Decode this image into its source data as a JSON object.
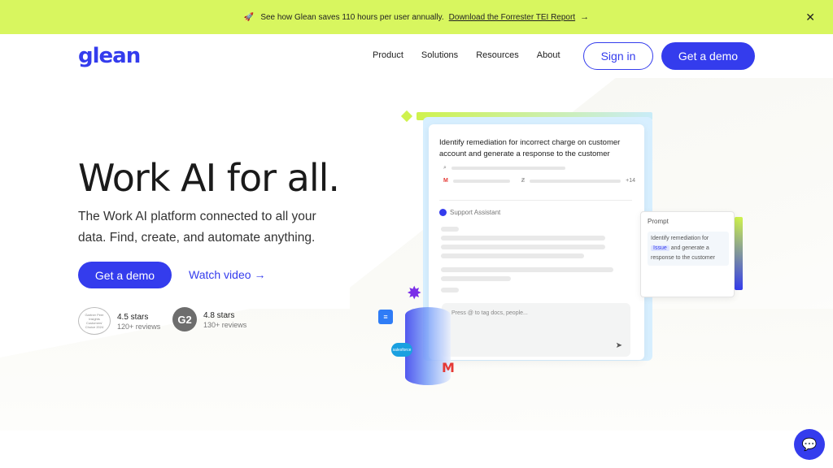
{
  "announcement": {
    "icon": "rocket-icon",
    "message": "See how Glean saves 110 hours per user annually.",
    "link_text": "Download the Forrester TEI Report",
    "arrow": "→",
    "close": "✕"
  },
  "nav": {
    "logo": "glean",
    "links": [
      "Product",
      "Solutions",
      "Resources",
      "About"
    ],
    "signin_label": "Sign in",
    "demo_label": "Get a demo"
  },
  "hero": {
    "title": "Work AI for all.",
    "subtitle": "The Work AI platform connected to all your data. Find, create, and automate anything.",
    "demo_label": "Get a demo",
    "watch_label": "Watch video",
    "watch_arrow": "→"
  },
  "badges": [
    {
      "logo_text": "Gartner Peer Insights Customers' Choice 2024",
      "stars": "4.5 stars",
      "reviews": "120+ reviews"
    },
    {
      "logo_text": "G2",
      "stars": "4.8 stars",
      "reviews": "130+ reviews"
    }
  ],
  "mockup": {
    "query": "Identify remediation for incorrect charge on customer account and generate a response to the customer",
    "source_count": "+14",
    "assistant_label": "Support Assistant",
    "input_placeholder": "Press @ to tag docs, people...",
    "send_icon": "➤",
    "prompt": {
      "title": "Prompt",
      "text_before": "Identify remediation for",
      "chip": "Issue",
      "text_after": "and generate a response to the customer"
    }
  },
  "floating": {
    "sf_label": "salesforce",
    "gmail_label": "M"
  },
  "colors": {
    "brand": "#343ced",
    "accent": "#d8f65f"
  }
}
